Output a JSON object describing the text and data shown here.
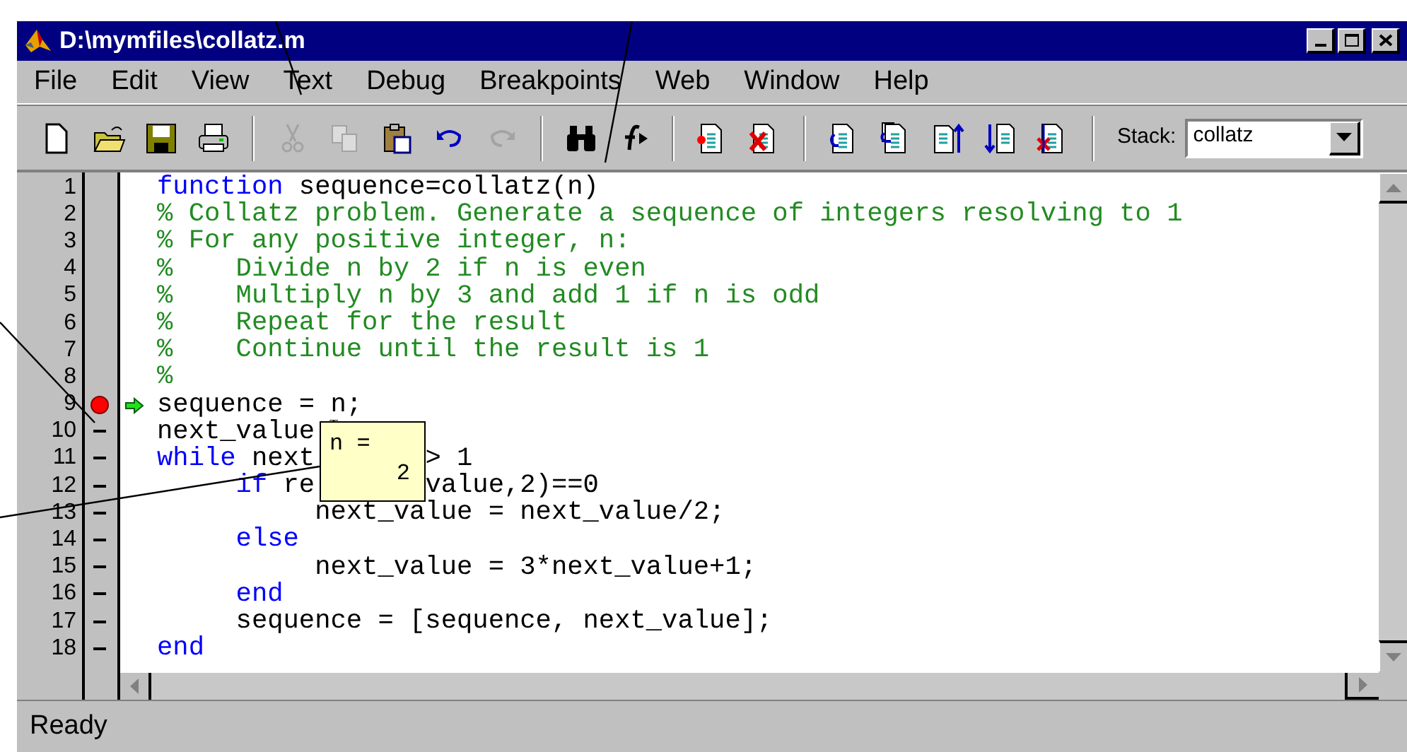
{
  "window": {
    "title": "D:\\mymfiles\\collatz.m"
  },
  "menu": [
    {
      "label": "File"
    },
    {
      "label": "Edit"
    },
    {
      "label": "View"
    },
    {
      "label": "Text"
    },
    {
      "label": "Debug"
    },
    {
      "label": "Breakpoints"
    },
    {
      "label": "Web"
    },
    {
      "label": "Window"
    },
    {
      "label": "Help"
    }
  ],
  "toolbar": [
    {
      "kind": "new",
      "disabled": false
    },
    {
      "kind": "open",
      "disabled": false
    },
    {
      "kind": "save",
      "disabled": false
    },
    {
      "kind": "print",
      "disabled": false
    },
    {
      "kind": "separator"
    },
    {
      "kind": "cut",
      "disabled": true
    },
    {
      "kind": "copy",
      "disabled": true
    },
    {
      "kind": "paste",
      "disabled": false
    },
    {
      "kind": "undo",
      "disabled": false
    },
    {
      "kind": "redo",
      "disabled": true
    },
    {
      "kind": "separator"
    },
    {
      "kind": "find",
      "disabled": false
    },
    {
      "kind": "function",
      "disabled": false
    },
    {
      "kind": "separator"
    },
    {
      "kind": "set-breakpoint",
      "disabled": false
    },
    {
      "kind": "clear-breakpoint",
      "disabled": false
    },
    {
      "kind": "separator"
    },
    {
      "kind": "step",
      "disabled": false
    },
    {
      "kind": "step-in",
      "disabled": false
    },
    {
      "kind": "step-out",
      "disabled": false
    },
    {
      "kind": "continue",
      "disabled": false
    },
    {
      "kind": "clear-all",
      "disabled": false
    },
    {
      "kind": "separator"
    }
  ],
  "stack": {
    "label": "Stack:",
    "value": "collatz"
  },
  "editor": {
    "lines": [
      {
        "number": "1",
        "breakpoint": false,
        "executable": false,
        "current": false,
        "parts": [
          [
            {
              "text": "function",
              "kind": "keyword"
            },
            {
              "text": " sequence=collatz(n)",
              "kind": "plain"
            }
          ]
        ]
      },
      {
        "number": "2",
        "breakpoint": false,
        "executable": false,
        "current": false,
        "parts": [
          [
            {
              "text": "% Collatz problem. Generate a sequence of integers resolving to 1",
              "kind": "comment"
            }
          ]
        ]
      },
      {
        "number": "3",
        "breakpoint": false,
        "executable": false,
        "current": false,
        "parts": [
          [
            {
              "text": "% For any positive integer, n:",
              "kind": "comment"
            }
          ]
        ]
      },
      {
        "number": "4",
        "breakpoint": false,
        "executable": false,
        "current": false,
        "parts": [
          [
            {
              "text": "%    Divide n by 2 if n is even",
              "kind": "comment"
            }
          ]
        ]
      },
      {
        "number": "5",
        "breakpoint": false,
        "executable": false,
        "current": false,
        "parts": [
          [
            {
              "text": "%    Multiply n by 3 and add 1 if n is odd",
              "kind": "comment"
            }
          ]
        ]
      },
      {
        "number": "6",
        "breakpoint": false,
        "executable": false,
        "current": false,
        "parts": [
          [
            {
              "text": "%    Repeat for the result",
              "kind": "comment"
            }
          ]
        ]
      },
      {
        "number": "7",
        "breakpoint": false,
        "executable": false,
        "current": false,
        "parts": [
          [
            {
              "text": "%    Continue until the result is 1",
              "kind": "comment"
            }
          ]
        ]
      },
      {
        "number": "8",
        "breakpoint": false,
        "executable": false,
        "current": false,
        "parts": [
          [
            {
              "text": "%",
              "kind": "comment"
            }
          ]
        ]
      },
      {
        "number": "9",
        "breakpoint": true,
        "executable": true,
        "current": true,
        "parts": [
          [
            {
              "text": "sequence = n;",
              "kind": "plain"
            }
          ]
        ]
      },
      {
        "number": "10",
        "breakpoint": false,
        "executable": true,
        "current": false,
        "parts": [
          [
            {
              "text": "next_value",
              "kind": "plain"
            }
          ]
        ]
      },
      {
        "number": "11",
        "breakpoint": false,
        "executable": true,
        "current": false,
        "parts": [
          [
            {
              "text": "while",
              "kind": "keyword"
            },
            {
              "text": " next",
              "kind": "plain"
            }
          ],
          [
            {
              "text": "> 1",
              "kind": "plain"
            }
          ]
        ]
      },
      {
        "number": "12",
        "breakpoint": false,
        "executable": true,
        "current": false,
        "parts": [
          [
            {
              "text": "     if",
              "kind": "keyword"
            },
            {
              "text": " re",
              "kind": "plain"
            }
          ],
          [
            {
              "text": "value,2)==0",
              "kind": "plain"
            }
          ]
        ]
      },
      {
        "number": "13",
        "breakpoint": false,
        "executable": true,
        "current": false,
        "parts": [
          [
            {
              "text": "          next_value = next_value/2;",
              "kind": "plain"
            }
          ]
        ]
      },
      {
        "number": "14",
        "breakpoint": false,
        "executable": true,
        "current": false,
        "parts": [
          [
            {
              "text": "     else",
              "kind": "keyword"
            }
          ]
        ]
      },
      {
        "number": "15",
        "breakpoint": false,
        "executable": true,
        "current": false,
        "parts": [
          [
            {
              "text": "          next_value = 3*next_value+1;",
              "kind": "plain"
            }
          ]
        ]
      },
      {
        "number": "16",
        "breakpoint": false,
        "executable": true,
        "current": false,
        "parts": [
          [
            {
              "text": "     end",
              "kind": "keyword"
            }
          ]
        ]
      },
      {
        "number": "17",
        "breakpoint": false,
        "executable": true,
        "current": false,
        "parts": [
          [
            {
              "text": "     sequence = [sequence, next_value];",
              "kind": "plain"
            }
          ]
        ]
      },
      {
        "number": "18",
        "breakpoint": false,
        "executable": true,
        "current": false,
        "parts": [
          [
            {
              "text": "end",
              "kind": "keyword"
            }
          ]
        ]
      }
    ],
    "tooltip": {
      "name": "n =",
      "value": "2"
    }
  },
  "status_bar": {
    "text": "Ready"
  }
}
